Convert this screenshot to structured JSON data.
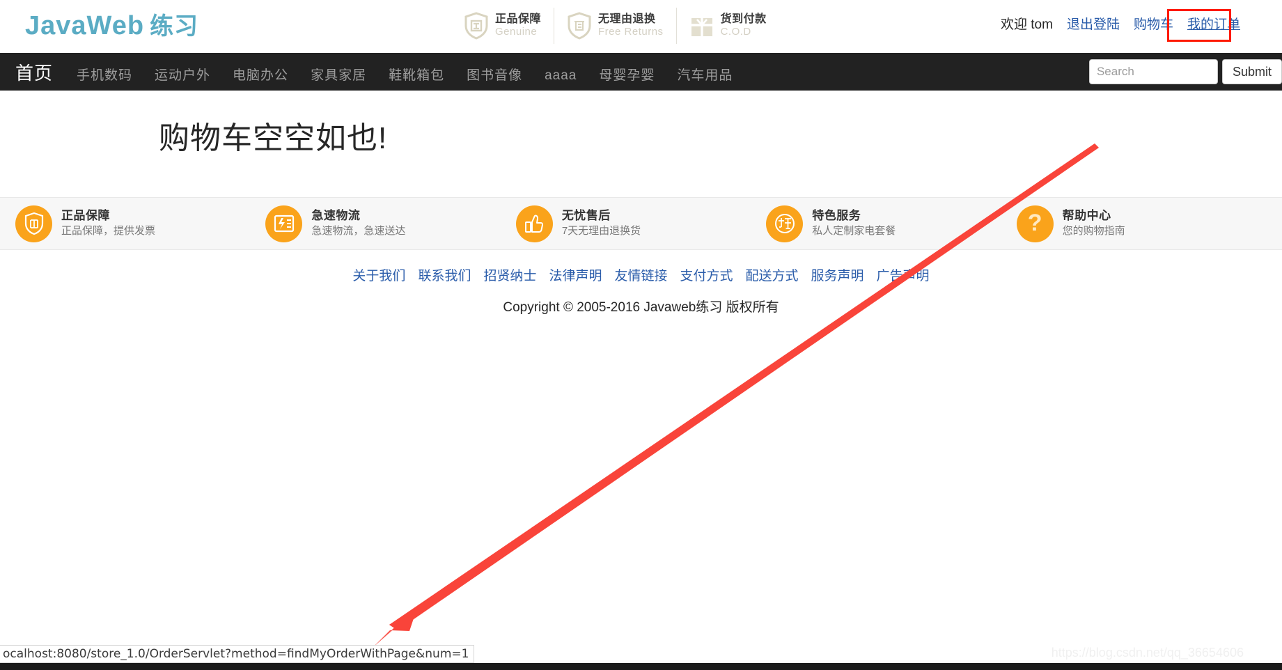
{
  "header": {
    "logo_main": "JavaWeb",
    "logo_cn": "练习",
    "logo_color": "#5bacc4",
    "badges": [
      {
        "icon": "shield-genuine-icon",
        "cn": "正品保障",
        "en": "Genuine"
      },
      {
        "icon": "shield-returns-icon",
        "cn": "无理由退换",
        "en": "Free Returns"
      },
      {
        "icon": "gift-box-icon",
        "cn": "货到付款",
        "en": "C.O.D"
      }
    ],
    "user": {
      "welcome": "欢迎 tom",
      "links": [
        {
          "label": "退出登陆"
        },
        {
          "label": "购物车"
        },
        {
          "label": "我的订单"
        }
      ],
      "link_color": "#2a5caa",
      "highlight_color": "#fe1900"
    }
  },
  "nav": {
    "home": "首页",
    "items": [
      "手机数码",
      "运动户外",
      "电脑办公",
      "家具家居",
      "鞋靴箱包",
      "图书音像",
      "aaaa",
      "母婴孕婴",
      "汽车用品"
    ],
    "search": {
      "placeholder": "Search",
      "value": "",
      "submit_label": "Submit"
    },
    "background": "#222222"
  },
  "main": {
    "empty_cart_title": "购物车空空如也!"
  },
  "features": {
    "accent_color": "#faa31b",
    "items": [
      {
        "icon": "shield-genuine-icon",
        "title": "正品保障",
        "sub": "正品保障，提供发票"
      },
      {
        "icon": "fast-delivery-icon",
        "title": "急速物流",
        "sub": "急速物流，急速送达"
      },
      {
        "icon": "thumbs-up-icon",
        "title": "无忧售后",
        "sub": "7天无理由退换货"
      },
      {
        "icon": "special-service-icon",
        "title": "特色服务",
        "sub": "私人定制家电套餐"
      },
      {
        "icon": "question-mark-icon",
        "title": "帮助中心",
        "sub": "您的购物指南"
      }
    ]
  },
  "footer": {
    "links": [
      "关于我们",
      "联系我们",
      "招贤纳士",
      "法律声明",
      "友情链接",
      "支付方式",
      "配送方式",
      "服务声明",
      "广告声明"
    ],
    "copyright": "Copyright © 2005-2016 Javaweb练习 版权所有"
  },
  "status_bar": {
    "url": "ocalhost:8080/store_1.0/OrderServlet?method=findMyOrderWithPage&num=1"
  },
  "watermark": {
    "text": "https://blog.csdn.net/qq_36654606"
  },
  "annotation": {
    "arrow_color": "#f9443a"
  }
}
